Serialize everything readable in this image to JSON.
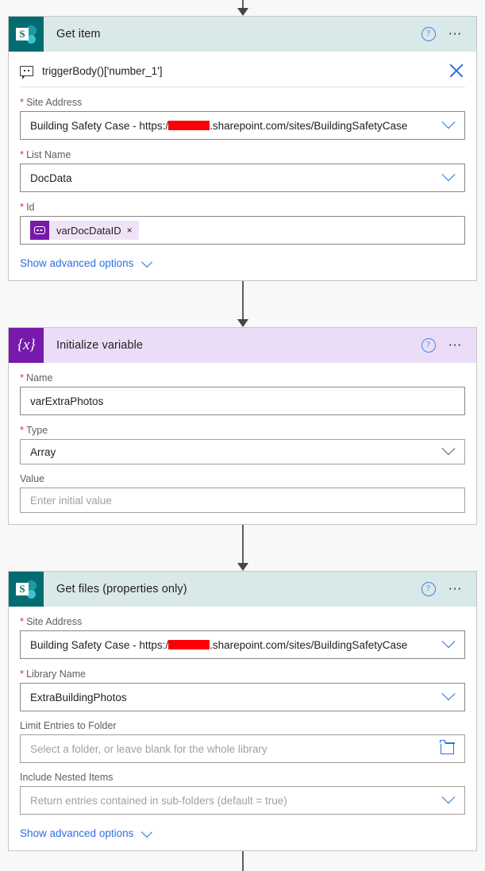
{
  "colors": {
    "sharepoint_teal": "#036c70",
    "sharepoint_header": "#d9e8e8",
    "variable_purple": "#7719aa",
    "variable_header": "#ebddf7",
    "link_blue": "#2f6fe0",
    "required_red": "#d13438",
    "redaction_red": "#fb0007",
    "page_background": "#f8f8f8"
  },
  "steps": [
    {
      "title": "Get item",
      "icon": "sharepoint-icon",
      "help_label": "?",
      "more_label": "•••",
      "trigger": {
        "icon": "comment-icon",
        "text": "triggerBody()['number_1']",
        "close_label": "×"
      },
      "fields": [
        {
          "label": "Site Address",
          "required": true,
          "value_prefix": "Building Safety Case - https:/",
          "redacted": true,
          "value_suffix": ".sharepoint.com/sites/BuildingSafetyCase",
          "control": "dropdown"
        },
        {
          "label": "List Name",
          "required": true,
          "value": "DocData",
          "control": "dropdown"
        },
        {
          "label": "Id",
          "required": true,
          "control": "token",
          "token": {
            "label": "varDocDataID",
            "remove_label": "×",
            "icon": "variable-token-icon"
          }
        }
      ],
      "advanced_label": "Show advanced options"
    },
    {
      "title": "Initialize variable",
      "icon": "variable-icon",
      "icon_glyph": "{x}",
      "help_label": "?",
      "more_label": "•••",
      "fields": [
        {
          "label": "Name",
          "required": true,
          "value": "varExtraPhotos",
          "control": "text"
        },
        {
          "label": "Type",
          "required": true,
          "value": "Array",
          "control": "dropdown-grey"
        },
        {
          "label": "Value",
          "required": false,
          "placeholder": "Enter initial value",
          "control": "text"
        }
      ]
    },
    {
      "title": "Get files (properties only)",
      "icon": "sharepoint-icon",
      "help_label": "?",
      "more_label": "•••",
      "fields": [
        {
          "label": "Site Address",
          "required": true,
          "value_prefix": "Building Safety Case - https:/",
          "redacted": true,
          "value_suffix": ".sharepoint.com/sites/BuildingSafetyCase",
          "control": "dropdown"
        },
        {
          "label": "Library Name",
          "required": true,
          "value": "ExtraBuildingPhotos",
          "control": "dropdown"
        },
        {
          "label": "Limit Entries to Folder",
          "required": false,
          "placeholder": "Select a folder, or leave blank for the whole library",
          "control": "folder-picker"
        },
        {
          "label": "Include Nested Items",
          "required": false,
          "placeholder": "Return entries contained in sub-folders (default = true)",
          "control": "dropdown"
        }
      ],
      "advanced_label": "Show advanced options"
    }
  ]
}
